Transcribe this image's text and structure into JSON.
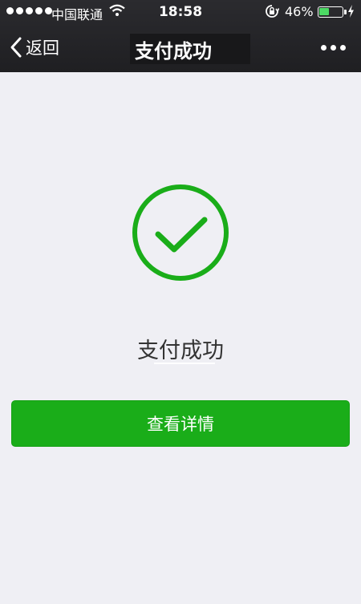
{
  "status_bar": {
    "carrier": "中国联通",
    "time": "18:58",
    "battery_percent": "46%",
    "battery_level": 0.46,
    "signal_dots": 5
  },
  "nav_bar": {
    "back_label": "返回",
    "title": "支付成功",
    "more_icon": "more-dots-icon"
  },
  "result": {
    "icon": "checkmark-circle-icon",
    "message": "支付成功",
    "accent_color": "#1aad19"
  },
  "actions": {
    "details_label": "查看详情"
  }
}
